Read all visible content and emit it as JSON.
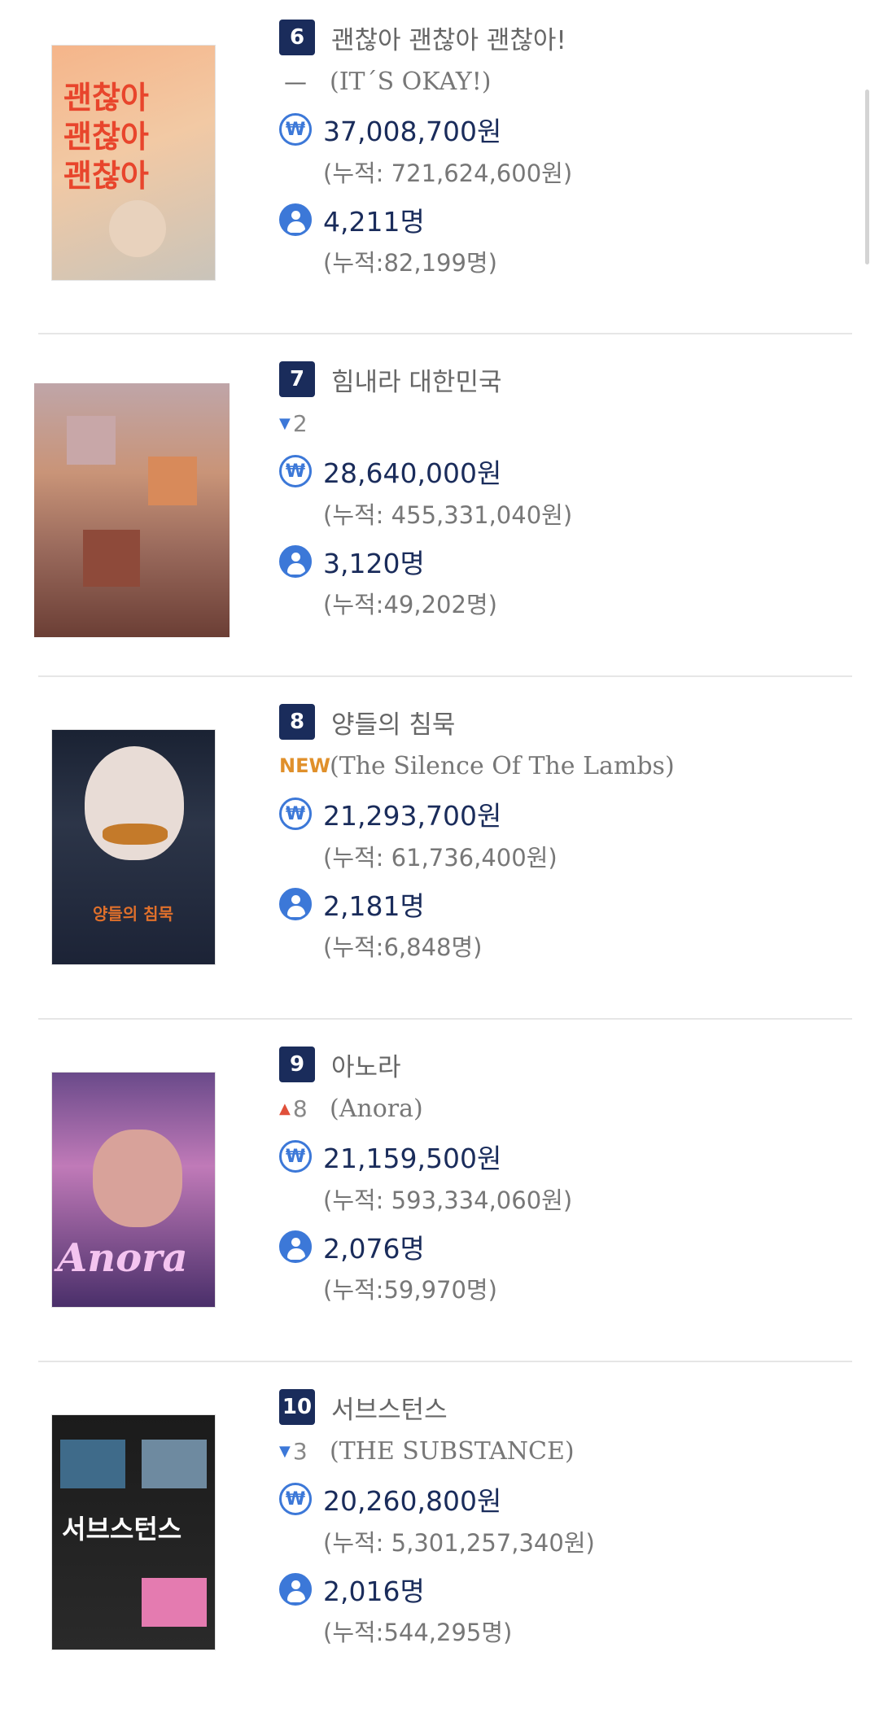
{
  "items": [
    {
      "rank": "6",
      "title": "괜찮아 괜찮아 괜찮아!",
      "change": "dash",
      "change_value": "",
      "english_title": "(IT´S OKAY!)",
      "revenue": "37,008,700원",
      "revenue_cumulative": "(누적: 721,624,600원)",
      "audience": "4,211명",
      "audience_cumulative": "(누적:82,199명)",
      "poster_text": "괜찮아\n괜찮아\n괜찮아"
    },
    {
      "rank": "7",
      "title": "힘내라 대한민국",
      "change": "down",
      "change_value": "2",
      "english_title": "",
      "revenue": "28,640,000원",
      "revenue_cumulative": "(누적: 455,331,040원)",
      "audience": "3,120명",
      "audience_cumulative": "(누적:49,202명)",
      "poster_text": ""
    },
    {
      "rank": "8",
      "title": "양들의 침묵",
      "change": "new",
      "change_value": "NEW",
      "english_title": "(The Silence Of The Lambs)",
      "revenue": "21,293,700원",
      "revenue_cumulative": "(누적: 61,736,400원)",
      "audience": "2,181명",
      "audience_cumulative": "(누적:6,848명)",
      "poster_text": "양들의 침묵"
    },
    {
      "rank": "9",
      "title": "아노라",
      "change": "up",
      "change_value": "8",
      "english_title": "(Anora)",
      "revenue": "21,159,500원",
      "revenue_cumulative": "(누적: 593,334,060원)",
      "audience": "2,076명",
      "audience_cumulative": "(누적:59,970명)",
      "poster_text": "Anora"
    },
    {
      "rank": "10",
      "title": "서브스턴스",
      "change": "down",
      "change_value": "3",
      "english_title": "(THE SUBSTANCE)",
      "revenue": "20,260,800원",
      "revenue_cumulative": "(누적: 5,301,257,340원)",
      "audience": "2,016명",
      "audience_cumulative": "(누적:544,295명)",
      "poster_text": "서브스턴스"
    }
  ],
  "icons": {
    "revenue": "won-coin-icon",
    "audience": "person-icon"
  },
  "colors": {
    "rank_bg": "#1a2c5b",
    "accent": "#3c78d8",
    "new": "#e0902b",
    "up": "#e0503a",
    "down": "#3c78d8"
  }
}
